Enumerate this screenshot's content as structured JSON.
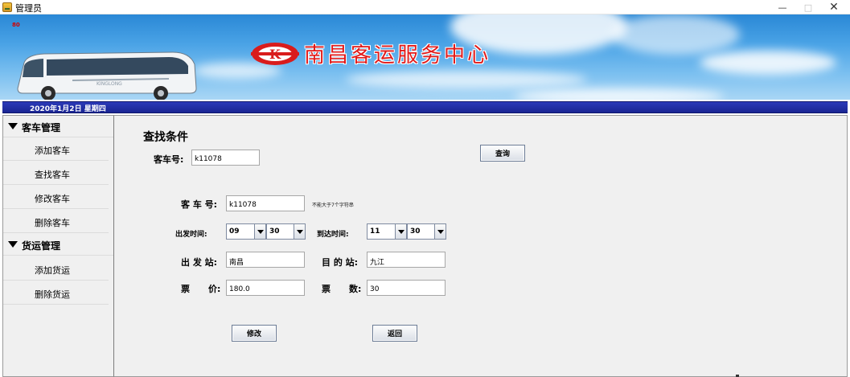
{
  "window": {
    "title": "管理员",
    "minimize_label": "—",
    "maximize_label": "□",
    "close_label": "✕"
  },
  "banner": {
    "tag": "80",
    "title": "南昌客运服务中心",
    "logo_letters": "K"
  },
  "datebar": {
    "date": "2020年1月2日  星期四"
  },
  "sidebar": {
    "groups": [
      {
        "label": "客车管理",
        "items": [
          "添加客车",
          "查找客车",
          "修改客车",
          "删除客车"
        ]
      },
      {
        "label": "货运管理",
        "items": [
          "添加货运",
          "删除货运"
        ]
      }
    ]
  },
  "search": {
    "title": "查找条件",
    "bus_no_label": "客车号:",
    "bus_no_value": "k11078",
    "query_button": "查询"
  },
  "form": {
    "bus_no_label": "客 车 号:",
    "bus_no_value": "k11078",
    "bus_no_hint": "不能大于7个字符串",
    "depart_label": "出发时间:",
    "depart_hour": "09",
    "depart_minute": "30",
    "arrive_label": "到达时间:",
    "arrive_hour": "11",
    "arrive_minute": "30",
    "origin_label": "出 发 站:",
    "origin_value": "南昌",
    "dest_label": "目 的 站:",
    "dest_value": "九江",
    "price_label": "票      价:",
    "price_value": "180.0",
    "count_label": "票      数:",
    "count_value": "30",
    "modify_button": "修改",
    "back_button": "返回"
  },
  "colors": {
    "date_strip": "#1a2592",
    "banner_title": "#e01a1a",
    "panel_bg": "#f0f0f0"
  }
}
